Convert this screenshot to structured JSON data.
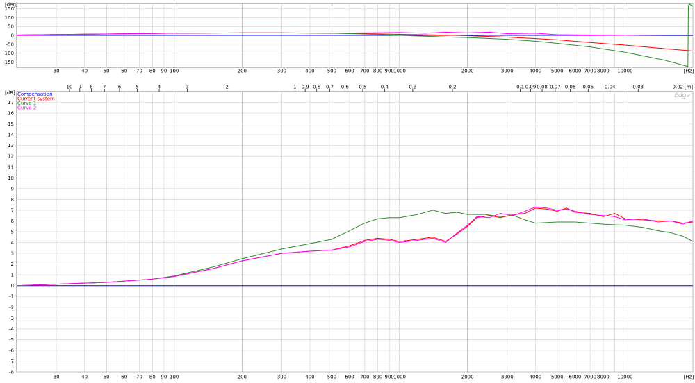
{
  "chart_data": [
    {
      "type": "line",
      "panel": "phase",
      "ylabel": "[deg]",
      "xlabel": "[Hz]",
      "xscale": "log",
      "xlim": [
        20,
        20000
      ],
      "ylim": [
        -180,
        180
      ],
      "yticks": [
        150,
        100,
        50,
        0,
        -50,
        -100,
        -150
      ],
      "grid": true,
      "series": [
        {
          "name": "Compensation",
          "color": "#0000ff",
          "x": [
            20,
            20000
          ],
          "y": [
            0,
            0
          ]
        },
        {
          "name": "Current system",
          "color": "#ff0000",
          "x": [
            20,
            30,
            50,
            100,
            200,
            300,
            500,
            700,
            1000,
            1500,
            2000,
            3000,
            4000,
            5000,
            7000,
            10000,
            15000,
            20000
          ],
          "y": [
            2,
            5,
            8,
            12,
            14,
            14,
            12,
            10,
            6,
            2,
            -2,
            -10,
            -18,
            -25,
            -40,
            -55,
            -75,
            -88
          ]
        },
        {
          "name": "Curve 1",
          "color": "#2e8b2e",
          "x": [
            20,
            30,
            50,
            100,
            200,
            300,
            500,
            700,
            1000,
            1500,
            2000,
            3000,
            4000,
            5000,
            7000,
            10000,
            15000,
            19000,
            19100,
            19400,
            20000
          ],
          "y": [
            2,
            5,
            8,
            12,
            14,
            14,
            12,
            8,
            0,
            -8,
            -12,
            -22,
            -33,
            -45,
            -65,
            -95,
            -140,
            -175,
            170,
            175,
            165
          ]
        },
        {
          "name": "Curve 2",
          "color": "#ff00ff",
          "x": [
            20,
            30,
            50,
            100,
            200,
            300,
            500,
            700,
            1000,
            1300,
            1600,
            2000,
            2500,
            3000,
            4000,
            5000,
            7000,
            10000,
            15000,
            20000
          ],
          "y": [
            2,
            5,
            8,
            12,
            14,
            14,
            13,
            14,
            16,
            12,
            18,
            14,
            18,
            10,
            12,
            4,
            2,
            0,
            -2,
            -2
          ]
        }
      ]
    },
    {
      "type": "line",
      "panel": "magnitude",
      "ylabel": "[dB]",
      "xlabel": "[Hz]",
      "top_axis_label": "[m]",
      "top_axis_ticks": [
        "10",
        "9",
        "8",
        "7",
        "6",
        "5",
        "4",
        "3",
        "2",
        "1",
        "0.9",
        "0.8",
        "0.7",
        "0.6",
        "0.5",
        "0.4",
        "0.3",
        "0.2",
        "0.1",
        "0.09",
        "0.08",
        "0.07",
        "0.06",
        "0.05",
        "0.04",
        "0.03",
        "0.02"
      ],
      "xscale": "log",
      "xlim": [
        20,
        20000
      ],
      "ylim": [
        -8,
        18
      ],
      "yticks": [
        17,
        16,
        15,
        14,
        13,
        12,
        11,
        10,
        9,
        8,
        7,
        6,
        5,
        4,
        3,
        2,
        1,
        0,
        -1,
        -2,
        -3,
        -4,
        -5,
        -6,
        -7,
        -8
      ],
      "xticks": [
        "30",
        "40",
        "50",
        "60",
        "70",
        "80",
        "90",
        "100",
        "200",
        "300",
        "400",
        "500",
        "600",
        "700",
        "800",
        "900",
        "1000",
        "2000",
        "3000",
        "4000",
        "5000",
        "6000",
        "7000",
        "8000",
        "10000"
      ],
      "grid": true,
      "legend": "top-left",
      "watermark": "Edge",
      "series": [
        {
          "name": "Compensation",
          "color": "#0000ff",
          "x": [
            20,
            20000
          ],
          "y": [
            0,
            0
          ]
        },
        {
          "name": "Current system",
          "color": "#ff0000",
          "x": [
            20,
            50,
            80,
            100,
            150,
            200,
            300,
            400,
            500,
            600,
            700,
            800,
            900,
            1000,
            1200,
            1400,
            1600,
            1800,
            2000,
            2200,
            2500,
            2800,
            3200,
            3600,
            4000,
            4500,
            5000,
            5500,
            6000,
            7000,
            8000,
            9000,
            10000,
            12000,
            14000,
            16000,
            18000,
            20000
          ],
          "y": [
            0,
            0.3,
            0.6,
            0.85,
            1.6,
            2.3,
            3.0,
            3.2,
            3.3,
            3.7,
            4.2,
            4.4,
            4.3,
            4.1,
            4.3,
            4.5,
            4.1,
            4.8,
            5.5,
            6.3,
            6.5,
            6.3,
            6.6,
            6.7,
            7.2,
            7.1,
            6.9,
            7.2,
            6.8,
            6.7,
            6.4,
            6.7,
            6.2,
            6.1,
            6.0,
            6.0,
            5.8,
            5.9
          ]
        },
        {
          "name": "Curve 1",
          "color": "#2e8b2e",
          "x": [
            20,
            50,
            80,
            100,
            150,
            200,
            300,
            400,
            500,
            600,
            700,
            800,
            900,
            1000,
            1200,
            1400,
            1600,
            1800,
            2000,
            2400,
            2800,
            3200,
            3600,
            4000,
            5000,
            6000,
            7000,
            8000,
            10000,
            12000,
            14000,
            16000,
            18000,
            20000
          ],
          "y": [
            0,
            0.3,
            0.6,
            0.9,
            1.75,
            2.5,
            3.4,
            3.9,
            4.3,
            5.1,
            5.8,
            6.2,
            6.3,
            6.3,
            6.6,
            7.0,
            6.7,
            6.8,
            6.6,
            6.6,
            6.4,
            6.5,
            6.1,
            5.8,
            5.9,
            5.9,
            5.8,
            5.7,
            5.6,
            5.4,
            5.1,
            4.9,
            4.6,
            4.1
          ]
        },
        {
          "name": "Curve 2",
          "color": "#ff00ff",
          "x": [
            20,
            50,
            80,
            100,
            150,
            200,
            300,
            400,
            500,
            600,
            700,
            800,
            900,
            1000,
            1200,
            1400,
            1600,
            1800,
            2000,
            2200,
            2500,
            2800,
            3200,
            3600,
            4000,
            4500,
            5000,
            5500,
            6000,
            7000,
            8000,
            9000,
            10000,
            12000,
            14000,
            16000,
            18000,
            20000
          ],
          "y": [
            0,
            0.3,
            0.6,
            0.85,
            1.6,
            2.3,
            3.0,
            3.2,
            3.3,
            3.6,
            4.1,
            4.3,
            4.2,
            4.0,
            4.2,
            4.4,
            4.0,
            4.9,
            5.6,
            6.4,
            6.3,
            6.7,
            6.5,
            6.9,
            7.3,
            7.2,
            7.0,
            7.1,
            6.9,
            6.6,
            6.5,
            6.4,
            6.1,
            6.2,
            5.9,
            6.0,
            5.7,
            6.0
          ]
        }
      ]
    }
  ]
}
